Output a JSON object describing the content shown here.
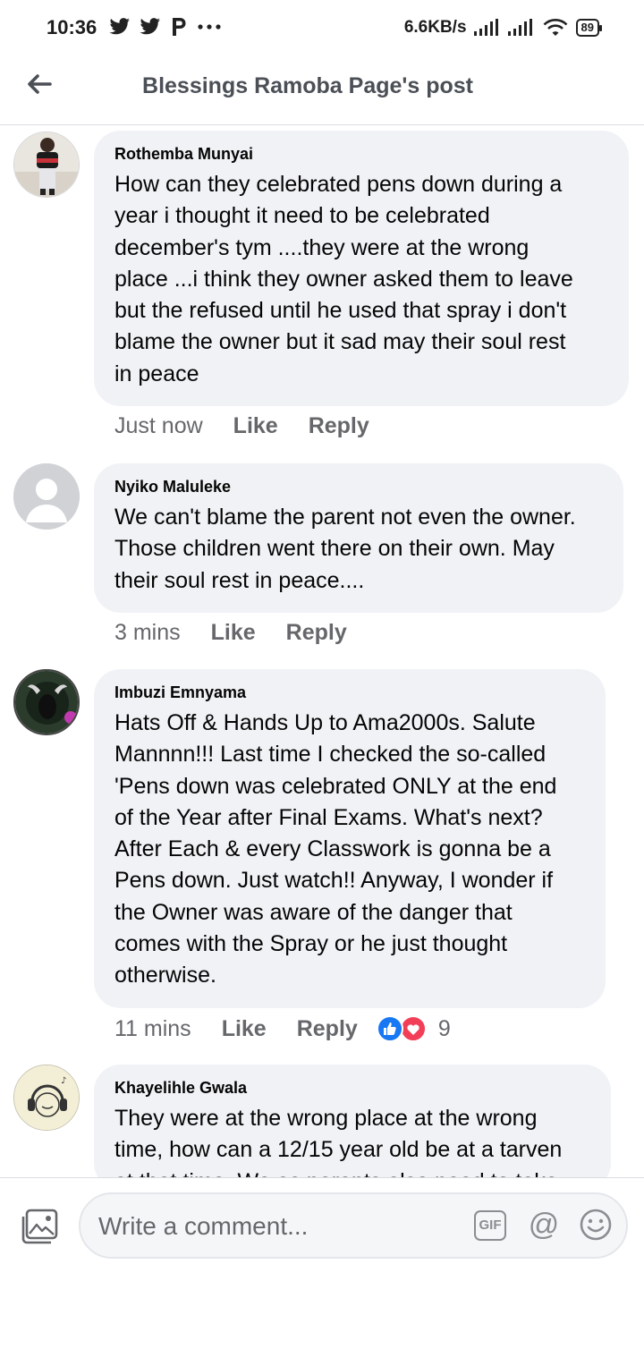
{
  "status_bar": {
    "time": "10:36",
    "network_speed": "6.6KB/s",
    "battery": "89",
    "icons": [
      "twitter-icon",
      "twitter-icon",
      "p-app-icon",
      "more-dots-icon",
      "signal-icon",
      "signal-icon",
      "wifi-icon",
      "battery-icon"
    ]
  },
  "header": {
    "title": "Blessings Ramoba Page's post"
  },
  "comments": [
    {
      "author": "Rothemba Munyai",
      "lines": [
        "How can they celebrated pens down during a",
        "year i thought it need to be celebrated",
        "december's tym ....they were at the wrong",
        "place ...i think they owner asked them to leave",
        "but the refused until he used that spray i don't",
        "blame the owner but it sad may their soul rest",
        "in peace"
      ],
      "time": "Just now",
      "like": "Like",
      "reply": "Reply"
    },
    {
      "author": "Nyiko Maluleke",
      "lines": [
        "We can't blame the parent not even the owner.",
        "Those children went there on their own. May",
        "their soul rest in peace...."
      ],
      "time": "3 mins",
      "like": "Like",
      "reply": "Reply"
    },
    {
      "author": "Imbuzi Emnyama",
      "lines": [
        "Hats Off & Hands Up to Ama2000s. Salute",
        "Mannnn!!! Last time I checked the so-called",
        "'Pens down was celebrated ONLY at the end",
        "of the Year after Final Exams. What's next?",
        "After Each & every Classwork is gonna be a",
        "Pens down. Just watch!! Anyway, I wonder if",
        "the Owner was aware of the danger that",
        "comes with the Spray or he just thought",
        "otherwise."
      ],
      "time": "11 mins",
      "like": "Like",
      "reply": "Reply",
      "reaction_count": "9",
      "reaction_colors": {
        "like": "#1877f2",
        "love": "#f33e58"
      }
    },
    {
      "author": "Khayelihle Gwala",
      "lines": [
        "They were at the wrong place at the wrong",
        "time, how can a 12/15 year old be at a tarven",
        "at that time. We as parents also need to take"
      ]
    }
  ],
  "composer": {
    "placeholder": "Write a comment...",
    "gif_label": "GIF",
    "at_label": "@"
  }
}
